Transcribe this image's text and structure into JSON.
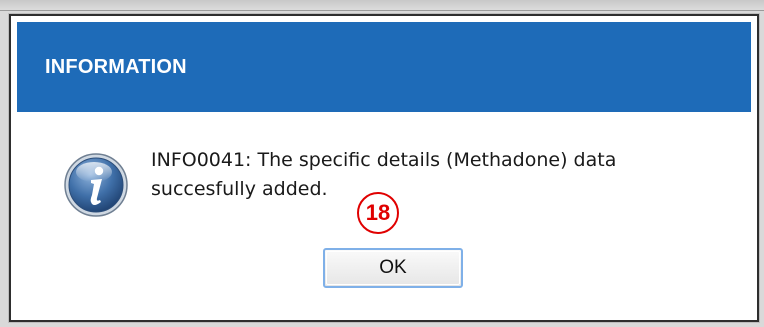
{
  "dialog": {
    "title": "INFORMATION",
    "message_line1": "INFO0041: The specific details (Methadone) data",
    "message_line2": "succesfully added.",
    "icon": "info-icon",
    "ok_label": "OK"
  },
  "annotation": {
    "step_number": "18",
    "color": "#e00000"
  },
  "colors": {
    "titlebar": "#1e6bb8",
    "title_text": "#ffffff"
  }
}
